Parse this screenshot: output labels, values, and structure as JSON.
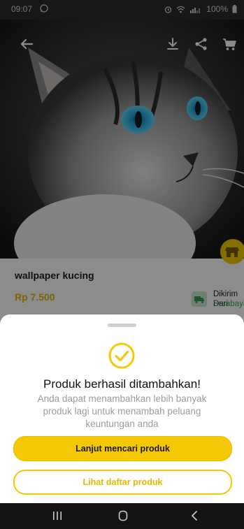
{
  "status_bar": {
    "time": "09:07",
    "battery": "100%",
    "icons": [
      "whatsapp-icon",
      "alarm-icon",
      "wifi-icon",
      "signal-icon",
      "battery-icon"
    ]
  },
  "top_bar": {
    "icons": [
      "back-arrow-icon",
      "download-icon",
      "share-icon",
      "cart-icon"
    ]
  },
  "product": {
    "name": "wallpaper kucing",
    "price": "Rp 7.500",
    "shipping_label": "Dikirim Dari",
    "shipping_city": "Surabaya"
  },
  "sheet": {
    "title": "Produk berhasil ditambahkan!",
    "subtitle": "Anda dapat menambahkan lebih banyak produk lagi untuk menambah peluang keuntungan anda",
    "primary_button": "Lanjut mencari produk",
    "secondary_button": "Lihat daftar produk"
  },
  "colors": {
    "accent": "#f4c805",
    "price": "#e0b400",
    "city": "#2f9e58"
  },
  "nav_bar": {
    "icons": [
      "recent-apps-icon",
      "home-icon",
      "back-icon"
    ]
  }
}
